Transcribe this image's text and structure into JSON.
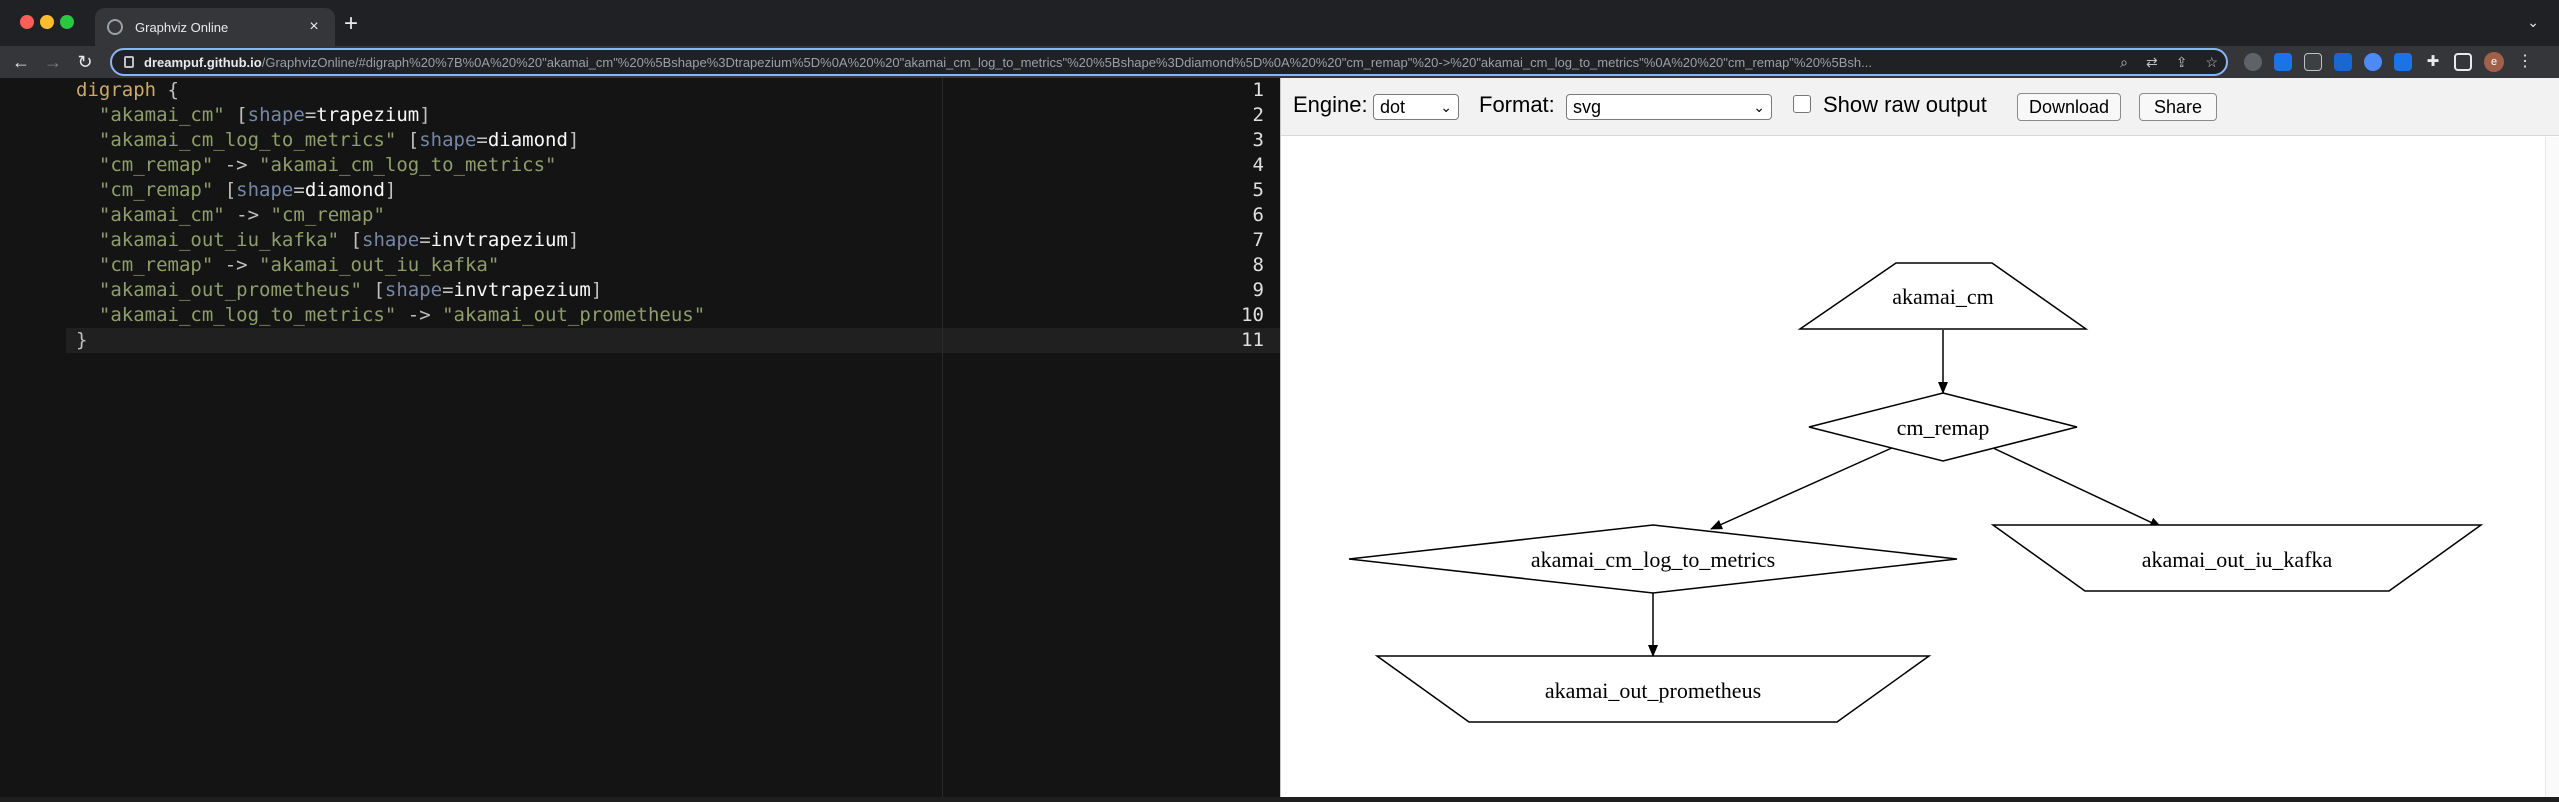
{
  "browser": {
    "tab_title": "Graphviz Online",
    "tab_close": "×",
    "new_tab": "+",
    "tab_menu": "⌄",
    "url_host": "dreampuf.github.io",
    "url_path": "/GraphvizOnline/#digraph%20%7B%0A%20%20\"akamai_cm\"%20%5Bshape%3Dtrapezium%5D%0A%20%20\"akamai_cm_log_to_metrics\"%20%5Bshape%3Ddiamond%5D%0A%20%20\"cm_remap\"%20->%20\"akamai_cm_log_to_metrics\"%0A%20%20\"cm_remap\"%20%5Bsh...",
    "avatar_letter": "e"
  },
  "editor": {
    "line_numbers": [
      "1",
      "2",
      "3",
      "4",
      "5",
      "6",
      "7",
      "8",
      "9",
      "10",
      "11"
    ]
  },
  "controls": {
    "engine_label": "Engine:",
    "engine_value": "dot",
    "format_label": "Format:",
    "format_value": "svg",
    "raw_label": "Show raw output",
    "download_label": "Download",
    "share_label": "Share"
  },
  "graph": {
    "nodes": {
      "akamai_cm": "akamai_cm",
      "cm_remap": "cm_remap",
      "akamai_cm_log_to_metrics": "akamai_cm_log_to_metrics",
      "akamai_out_iu_kafka": "akamai_out_iu_kafka",
      "akamai_out_prometheus": "akamai_out_prometheus"
    }
  }
}
